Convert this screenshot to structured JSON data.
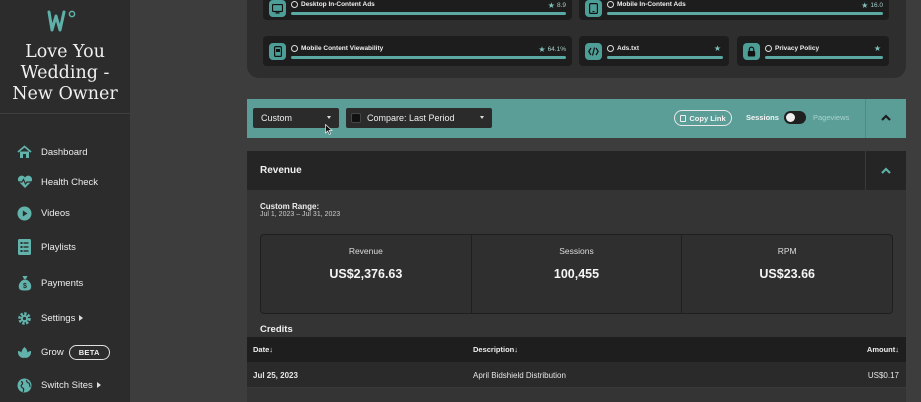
{
  "sidebar": {
    "site_title_line1": "Love You",
    "site_title_line2": "Wedding -",
    "site_title_line3": "New Owner",
    "items": [
      {
        "label": "Dashboard",
        "icon": "home-icon"
      },
      {
        "label": "Health Check",
        "icon": "heartbeat-icon"
      },
      {
        "label": "Videos",
        "icon": "play-icon"
      },
      {
        "label": "Playlists",
        "icon": "list-icon"
      },
      {
        "label": "Payments",
        "icon": "money-bag-icon"
      },
      {
        "label": "Settings",
        "icon": "gear-icon"
      },
      {
        "label": "Grow",
        "icon": "leaf-icon",
        "badge": "BETA"
      },
      {
        "label": "Switch Sites",
        "icon": "globe-icon"
      }
    ]
  },
  "health": {
    "items": [
      {
        "name": "Desktop In-Content Ads",
        "score": "8.9",
        "icon": "desktop-icon"
      },
      {
        "name": "Mobile In-Content Ads",
        "score": "16.0",
        "icon": "tablet-icon"
      },
      {
        "name": "Mobile Content Viewability",
        "score": "64.1%",
        "icon": "mobile-icon"
      },
      {
        "name": "Ads.txt",
        "score": "",
        "icon": "code-icon"
      },
      {
        "name": "Privacy Policy",
        "score": "",
        "icon": "lock-icon"
      }
    ]
  },
  "toolbar": {
    "date_select": "Custom",
    "compare_select": "Compare: Last Period",
    "copy_link": "Copy Link",
    "sessions_label": "Sessions",
    "pageviews_label": "Pageviews"
  },
  "revenue": {
    "title": "Revenue",
    "range_label": "Custom Range:",
    "range_value": "Jul 1, 2023 – Jul 31, 2023",
    "metrics": [
      {
        "name": "Revenue",
        "value": "US$2,376.63"
      },
      {
        "name": "Sessions",
        "value": "100,455"
      },
      {
        "name": "RPM",
        "value": "US$23.66"
      }
    ],
    "credits_title": "Credits",
    "columns": {
      "date": "Date↓",
      "description": "Description↓",
      "amount": "Amount↓"
    },
    "rows": [
      {
        "date": "Jul 25, 2023",
        "description": "April Bidshield Distribution",
        "amount": "US$0.17"
      }
    ]
  },
  "colors": {
    "accent": "#5b9e98",
    "sidebar": "#2c2c2c",
    "background": "#3d3d3d"
  }
}
